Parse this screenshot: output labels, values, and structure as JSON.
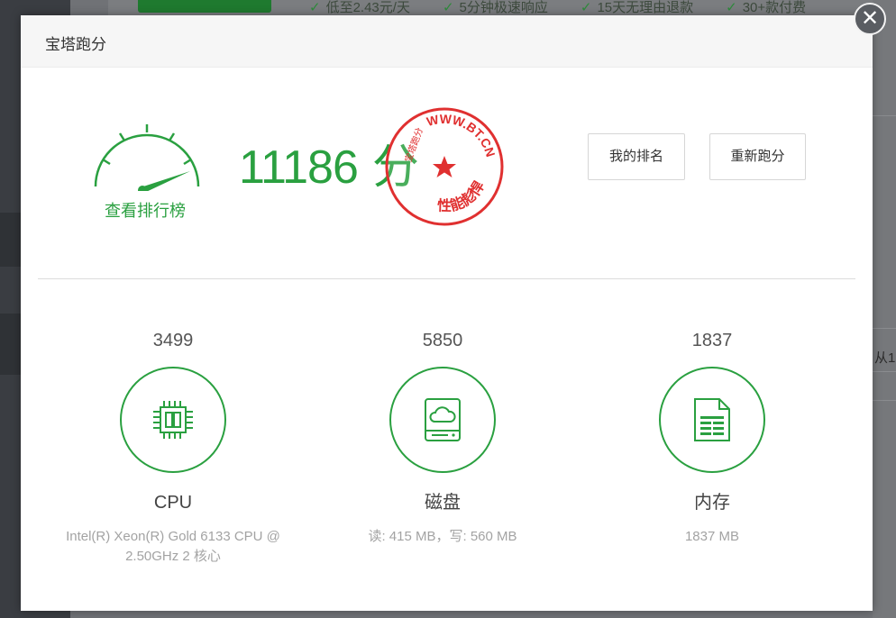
{
  "background": {
    "features": [
      "低至2.43元/天",
      "5分钟极速响应",
      "15天无理由退款",
      "30+款付费"
    ],
    "edge_text": "从1"
  },
  "dialog": {
    "title": "宝塔跑分",
    "close_glyph": "✕"
  },
  "score": {
    "value": "11186",
    "unit": "分",
    "ranking_link": "查看排行榜"
  },
  "stamp": {
    "url": "WWW.BT.CN",
    "left_text": "宝塔跑分",
    "bottom_text": "性能彪悍"
  },
  "buttons": {
    "my_rank": "我的排名",
    "rerun": "重新跑分"
  },
  "metrics": {
    "cpu": {
      "value": "3499",
      "name": "CPU",
      "desc": "Intel(R) Xeon(R) Gold 6133 CPU @ 2.50GHz 2 核心",
      "icon": "cpu-chip-icon"
    },
    "disk": {
      "value": "5850",
      "name": "磁盘",
      "desc": "读: 415 MB，写: 560 MB",
      "icon": "cloud-disk-icon"
    },
    "memory": {
      "value": "1837",
      "name": "内存",
      "desc": "1837 MB",
      "icon": "memory-card-icon"
    }
  },
  "colors": {
    "accent_green": "#2aa040",
    "stamp_red": "#e03030"
  }
}
